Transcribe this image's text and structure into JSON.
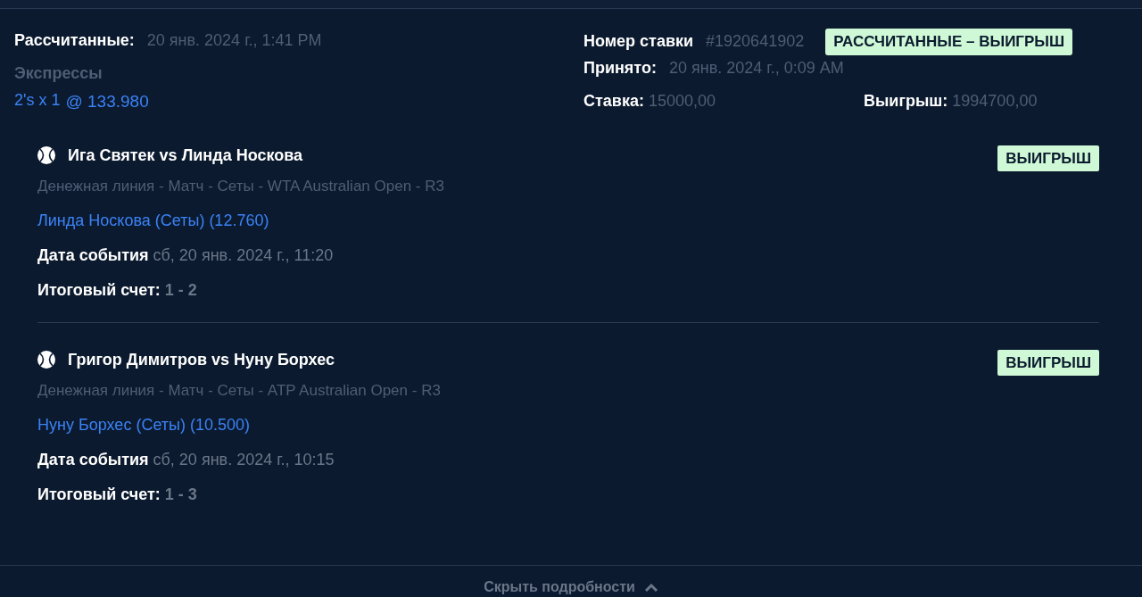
{
  "summary": {
    "settled_label": "Рассчитанные:",
    "settled_time": "20 янв. 2024 г., 1:41 PM",
    "bet_type": "Экспрессы",
    "system": "2's x 1",
    "odds": "@ 133.980",
    "bet_number_label": "Номер ставки",
    "bet_number": "#1920641902",
    "status": "РАССЧИТАННЫЕ – ВЫИГРЫШ",
    "accepted_label": "Принято:",
    "accepted_time": "20 янв. 2024 г., 0:09 AM",
    "stake_label": "Ставка:",
    "stake": "15000,00",
    "payout_label": "Выигрыш:",
    "payout": "1994700,00"
  },
  "legs": [
    {
      "match": "Ига Святек vs Линда Носкова",
      "result": "ВЫИГРЫШ",
      "market": "Денежная линия - Матч - Сеты - WTA Australian Open - R3",
      "selection": "Линда Носкова (Сеты) (12.760)",
      "date_label": "Дата события",
      "date": "сб, 20 янв. 2024 г., 11:20",
      "score_label": "Итоговый счет:",
      "score": "1 - 2"
    },
    {
      "match": "Григор Димитров vs Нуну Борхес",
      "result": "ВЫИГРЫШ",
      "market": "Денежная линия - Матч - Сеты - ATP Australian Open - R3",
      "selection": "Нуну Борхес (Сеты) (10.500)",
      "date_label": "Дата события",
      "date": "сб, 20 янв. 2024 г., 10:15",
      "score_label": "Итоговый счет:",
      "score": "1 - 3"
    }
  ],
  "footer": {
    "toggle": "Скрыть подробности"
  }
}
